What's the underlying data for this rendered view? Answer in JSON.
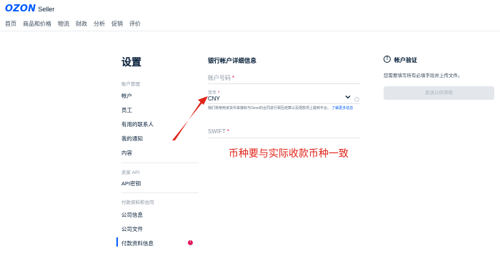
{
  "header": {
    "logo_brand": "OZON",
    "logo_suffix": "Seller",
    "nav": [
      "首页",
      "商品和价格",
      "物流",
      "财政",
      "分析",
      "促销",
      "评价"
    ]
  },
  "sidebar": {
    "title": "设置",
    "groups": [
      {
        "label": "账户管理",
        "items": [
          "帐户",
          "员工",
          "有用的联系人",
          "我的通知",
          "内容"
        ]
      },
      {
        "label": "卖家 API",
        "items": [
          "API密钥"
        ]
      },
      {
        "label": "付款资料和合同",
        "items": [
          "公司信息",
          "公司文件",
          "付款资料信息"
        ]
      }
    ],
    "active_item": "付款资料信息",
    "alert_badge": "!"
  },
  "form": {
    "section_title": "银行帐户详细信息",
    "account_number_label": "账户号码",
    "currency_label": "货币",
    "currency_value": "CNY",
    "currency_hint": "我们将使用该货币来接收与Ozon的合同进行相互结算以及把款项上载到平台。",
    "currency_hint_link": "了解更多信息",
    "swift_label": "SWIFT",
    "required_mark": "*"
  },
  "annotation": {
    "text": "币种要与实际收款币种一致",
    "color": "#e0241a"
  },
  "verification": {
    "title": "帐户验证",
    "description": "您需要填写所有必填字段并上传文件。",
    "button_label": "发送以供审核"
  },
  "colors": {
    "brand": "#005bff",
    "required": "#e0175e",
    "annotation": "#e0241a"
  },
  "icons": {
    "info": "info-circle-icon",
    "select": "chevron-down-icon",
    "alert": "alert-badge-icon"
  }
}
